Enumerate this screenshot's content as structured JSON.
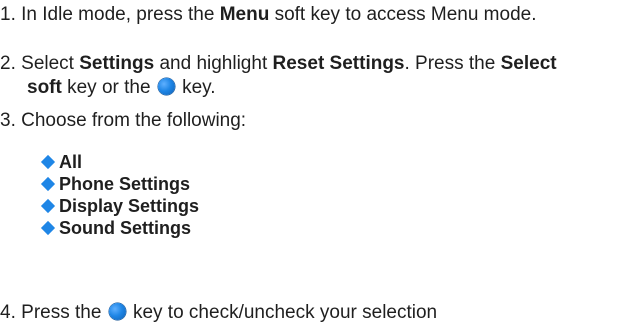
{
  "colors": {
    "bullet": "#1f86e6",
    "text": "#1f1f1f"
  },
  "steps": [
    {
      "num": "1.",
      "t1": "In Idle mode, press the ",
      "b1": "Menu",
      "t2": " soft key to access Menu mode."
    },
    {
      "num": "2.",
      "t1": "Select ",
      "b1": "Settings",
      "t2": " and highlight ",
      "b2": "Reset Settings",
      "t3": ". Press the ",
      "b3": "Select",
      "b4": "soft",
      "t4": " key or the ",
      "t5": " key."
    },
    {
      "num": "3.",
      "t1": "Choose from the following:"
    },
    {
      "num": "4.",
      "t1": "Press the ",
      "t2": " key to check/uncheck your selection"
    }
  ],
  "options": [
    "All",
    "Phone Settings",
    "Display Settings",
    "Sound Settings"
  ],
  "icons": {
    "select_key": "blue-circle-key-icon",
    "bullet": "diamond-bullet-icon"
  }
}
